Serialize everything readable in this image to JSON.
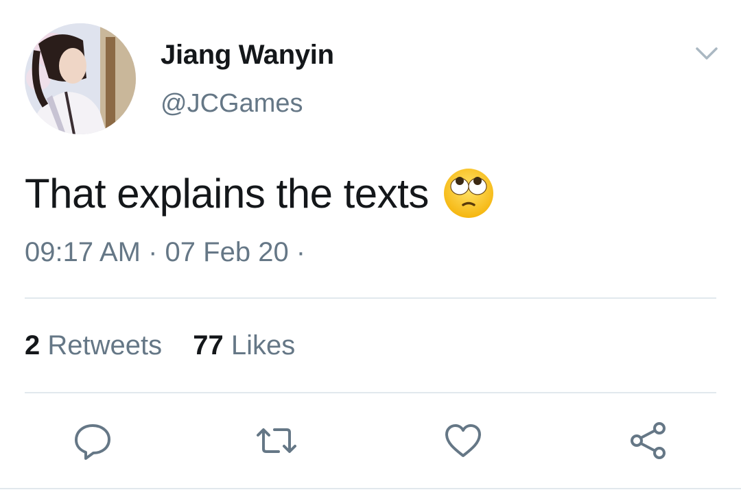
{
  "tweet": {
    "author": {
      "display_name": "Jiang Wanyin",
      "handle": "@JCGames",
      "avatar": "avatar"
    },
    "text": "That explains the texts",
    "emoji": "face-with-rolling-eyes",
    "timestamp": "09:17 AM · 07 Feb 20 ·",
    "stats": {
      "retweets": {
        "count": "2",
        "label": "Retweets"
      },
      "likes": {
        "count": "77",
        "label": "Likes"
      }
    },
    "actions": [
      "reply-icon",
      "retweet-icon",
      "like-icon",
      "share-icon"
    ]
  },
  "colors": {
    "text_primary": "#14171a",
    "text_secondary": "#657786",
    "divider": "#e1e8ed"
  }
}
